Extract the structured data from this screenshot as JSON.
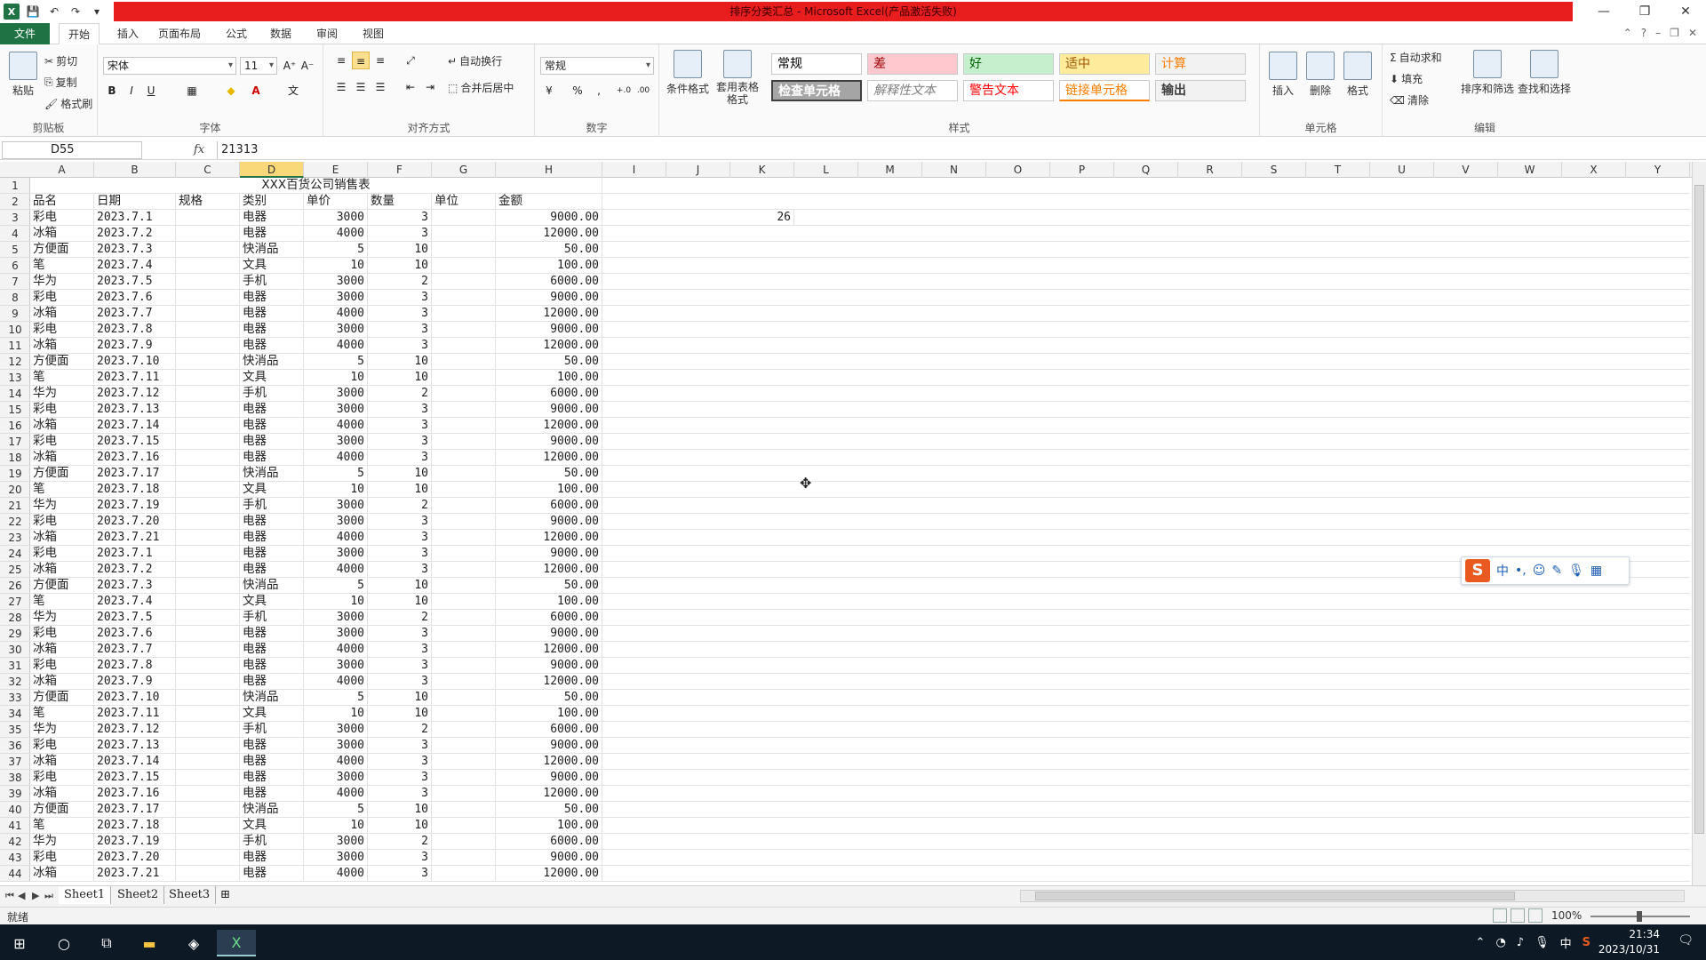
{
  "window": {
    "title": "排序分类汇总 - Microsoft Excel(产品激活失败)",
    "minimize": "—",
    "restore": "❐",
    "close": "✕"
  },
  "ribbon_tabs": [
    "文件",
    "开始",
    "插入",
    "页面布局",
    "公式",
    "数据",
    "审阅",
    "视图"
  ],
  "ribbon": {
    "clipboard": {
      "paste": "粘贴",
      "cut": "剪切",
      "copy": "复制",
      "format_painter": "格式刷",
      "label": "剪贴板"
    },
    "font": {
      "name": "宋体",
      "size": "11",
      "bold": "B",
      "italic": "I",
      "underline": "U",
      "label": "字体"
    },
    "alignment": {
      "wrap": "自动换行",
      "merge": "合并后居中",
      "label": "对齐方式"
    },
    "number": {
      "format": "常规",
      "percent": "%",
      "comma": ",",
      "label": "数字"
    },
    "styles": {
      "conditional": "条件格式",
      "table": "套用表格格式",
      "cells": [
        {
          "text": "常规",
          "bg": "#ffffff",
          "color": "#000000"
        },
        {
          "text": "差",
          "bg": "#ffc7ce",
          "color": "#9c0006"
        },
        {
          "text": "好",
          "bg": "#c6efce",
          "color": "#006100"
        },
        {
          "text": "适中",
          "bg": "#ffeb9c",
          "color": "#9c5700"
        },
        {
          "text": "计算",
          "bg": "#f2f2f2",
          "color": "#fa7d00"
        },
        {
          "text": "检查单元格",
          "bg": "#a5a5a5",
          "color": "#ffffff"
        },
        {
          "text": "解释性文本",
          "bg": "#ffffff",
          "color": "#7f7f7f"
        },
        {
          "text": "警告文本",
          "bg": "#ffffff",
          "color": "#ff0000"
        },
        {
          "text": "链接单元格",
          "bg": "#ffffff",
          "color": "#fa7d00"
        },
        {
          "text": "输出",
          "bg": "#f2f2f2",
          "color": "#3f3f3f"
        }
      ],
      "label": "样式"
    },
    "cells_group": {
      "insert": "插入",
      "delete": "删除",
      "format": "格式",
      "label": "单元格"
    },
    "editing": {
      "autosum": "自动求和",
      "fill": "填充",
      "clear": "清除",
      "sort": "排序和筛选",
      "find": "查找和选择",
      "label": "编辑"
    }
  },
  "formula_bar": {
    "name_box": "D55",
    "fx": "fx",
    "value": "21313"
  },
  "columns": [
    "A",
    "B",
    "C",
    "D",
    "E",
    "F",
    "G",
    "H",
    "I",
    "J",
    "K",
    "L",
    "M",
    "N",
    "O",
    "P",
    "Q",
    "R",
    "S",
    "T",
    "U",
    "V",
    "W",
    "X",
    "Y"
  ],
  "selected_column": "D",
  "title_row": "XXX百货公司销售表",
  "header": [
    "品名",
    "日期",
    "规格",
    "类别",
    "单价",
    "数量",
    "单位",
    "金额"
  ],
  "rows": [
    [
      "彩电",
      "2023.7.1",
      "",
      "电器",
      "3000",
      "3",
      "",
      "9000.00"
    ],
    [
      "冰箱",
      "2023.7.2",
      "",
      "电器",
      "4000",
      "3",
      "",
      "12000.00"
    ],
    [
      "方便面",
      "2023.7.3",
      "",
      "快消品",
      "5",
      "10",
      "",
      "50.00"
    ],
    [
      "笔",
      "2023.7.4",
      "",
      "文具",
      "10",
      "10",
      "",
      "100.00"
    ],
    [
      "华为",
      "2023.7.5",
      "",
      "手机",
      "3000",
      "2",
      "",
      "6000.00"
    ],
    [
      "彩电",
      "2023.7.6",
      "",
      "电器",
      "3000",
      "3",
      "",
      "9000.00"
    ],
    [
      "冰箱",
      "2023.7.7",
      "",
      "电器",
      "4000",
      "3",
      "",
      "12000.00"
    ],
    [
      "彩电",
      "2023.7.8",
      "",
      "电器",
      "3000",
      "3",
      "",
      "9000.00"
    ],
    [
      "冰箱",
      "2023.7.9",
      "",
      "电器",
      "4000",
      "3",
      "",
      "12000.00"
    ],
    [
      "方便面",
      "2023.7.10",
      "",
      "快消品",
      "5",
      "10",
      "",
      "50.00"
    ],
    [
      "笔",
      "2023.7.11",
      "",
      "文具",
      "10",
      "10",
      "",
      "100.00"
    ],
    [
      "华为",
      "2023.7.12",
      "",
      "手机",
      "3000",
      "2",
      "",
      "6000.00"
    ],
    [
      "彩电",
      "2023.7.13",
      "",
      "电器",
      "3000",
      "3",
      "",
      "9000.00"
    ],
    [
      "冰箱",
      "2023.7.14",
      "",
      "电器",
      "4000",
      "3",
      "",
      "12000.00"
    ],
    [
      "彩电",
      "2023.7.15",
      "",
      "电器",
      "3000",
      "3",
      "",
      "9000.00"
    ],
    [
      "冰箱",
      "2023.7.16",
      "",
      "电器",
      "4000",
      "3",
      "",
      "12000.00"
    ],
    [
      "方便面",
      "2023.7.17",
      "",
      "快消品",
      "5",
      "10",
      "",
      "50.00"
    ],
    [
      "笔",
      "2023.7.18",
      "",
      "文具",
      "10",
      "10",
      "",
      "100.00"
    ],
    [
      "华为",
      "2023.7.19",
      "",
      "手机",
      "3000",
      "2",
      "",
      "6000.00"
    ],
    [
      "彩电",
      "2023.7.20",
      "",
      "电器",
      "3000",
      "3",
      "",
      "9000.00"
    ],
    [
      "冰箱",
      "2023.7.21",
      "",
      "电器",
      "4000",
      "3",
      "",
      "12000.00"
    ],
    [
      "彩电",
      "2023.7.1",
      "",
      "电器",
      "3000",
      "3",
      "",
      "9000.00"
    ],
    [
      "冰箱",
      "2023.7.2",
      "",
      "电器",
      "4000",
      "3",
      "",
      "12000.00"
    ],
    [
      "方便面",
      "2023.7.3",
      "",
      "快消品",
      "5",
      "10",
      "",
      "50.00"
    ],
    [
      "笔",
      "2023.7.4",
      "",
      "文具",
      "10",
      "10",
      "",
      "100.00"
    ],
    [
      "华为",
      "2023.7.5",
      "",
      "手机",
      "3000",
      "2",
      "",
      "6000.00"
    ],
    [
      "彩电",
      "2023.7.6",
      "",
      "电器",
      "3000",
      "3",
      "",
      "9000.00"
    ],
    [
      "冰箱",
      "2023.7.7",
      "",
      "电器",
      "4000",
      "3",
      "",
      "12000.00"
    ],
    [
      "彩电",
      "2023.7.8",
      "",
      "电器",
      "3000",
      "3",
      "",
      "9000.00"
    ],
    [
      "冰箱",
      "2023.7.9",
      "",
      "电器",
      "4000",
      "3",
      "",
      "12000.00"
    ],
    [
      "方便面",
      "2023.7.10",
      "",
      "快消品",
      "5",
      "10",
      "",
      "50.00"
    ],
    [
      "笔",
      "2023.7.11",
      "",
      "文具",
      "10",
      "10",
      "",
      "100.00"
    ],
    [
      "华为",
      "2023.7.12",
      "",
      "手机",
      "3000",
      "2",
      "",
      "6000.00"
    ],
    [
      "彩电",
      "2023.7.13",
      "",
      "电器",
      "3000",
      "3",
      "",
      "9000.00"
    ],
    [
      "冰箱",
      "2023.7.14",
      "",
      "电器",
      "4000",
      "3",
      "",
      "12000.00"
    ],
    [
      "彩电",
      "2023.7.15",
      "",
      "电器",
      "3000",
      "3",
      "",
      "9000.00"
    ],
    [
      "冰箱",
      "2023.7.16",
      "",
      "电器",
      "4000",
      "3",
      "",
      "12000.00"
    ],
    [
      "方便面",
      "2023.7.17",
      "",
      "快消品",
      "5",
      "10",
      "",
      "50.00"
    ],
    [
      "笔",
      "2023.7.18",
      "",
      "文具",
      "10",
      "10",
      "",
      "100.00"
    ],
    [
      "华为",
      "2023.7.19",
      "",
      "手机",
      "3000",
      "2",
      "",
      "6000.00"
    ],
    [
      "彩电",
      "2023.7.20",
      "",
      "电器",
      "3000",
      "3",
      "",
      "9000.00"
    ],
    [
      "冰箱",
      "2023.7.21",
      "",
      "电器",
      "4000",
      "3",
      "",
      "12000.00"
    ]
  ],
  "k3_value": "26",
  "sheets": [
    "Sheet1",
    "Sheet2",
    "Sheet3"
  ],
  "status": {
    "ready": "就绪",
    "zoom": "100%"
  },
  "taskbar": {
    "time": "21:34",
    "date": "2023/10/31",
    "ime_lang": "中"
  },
  "ime_bar": {
    "mode": "中",
    "punct": "•,",
    "emoji": "☺",
    "pen": "✎",
    "mic": "🎙",
    "grid": "▦"
  }
}
